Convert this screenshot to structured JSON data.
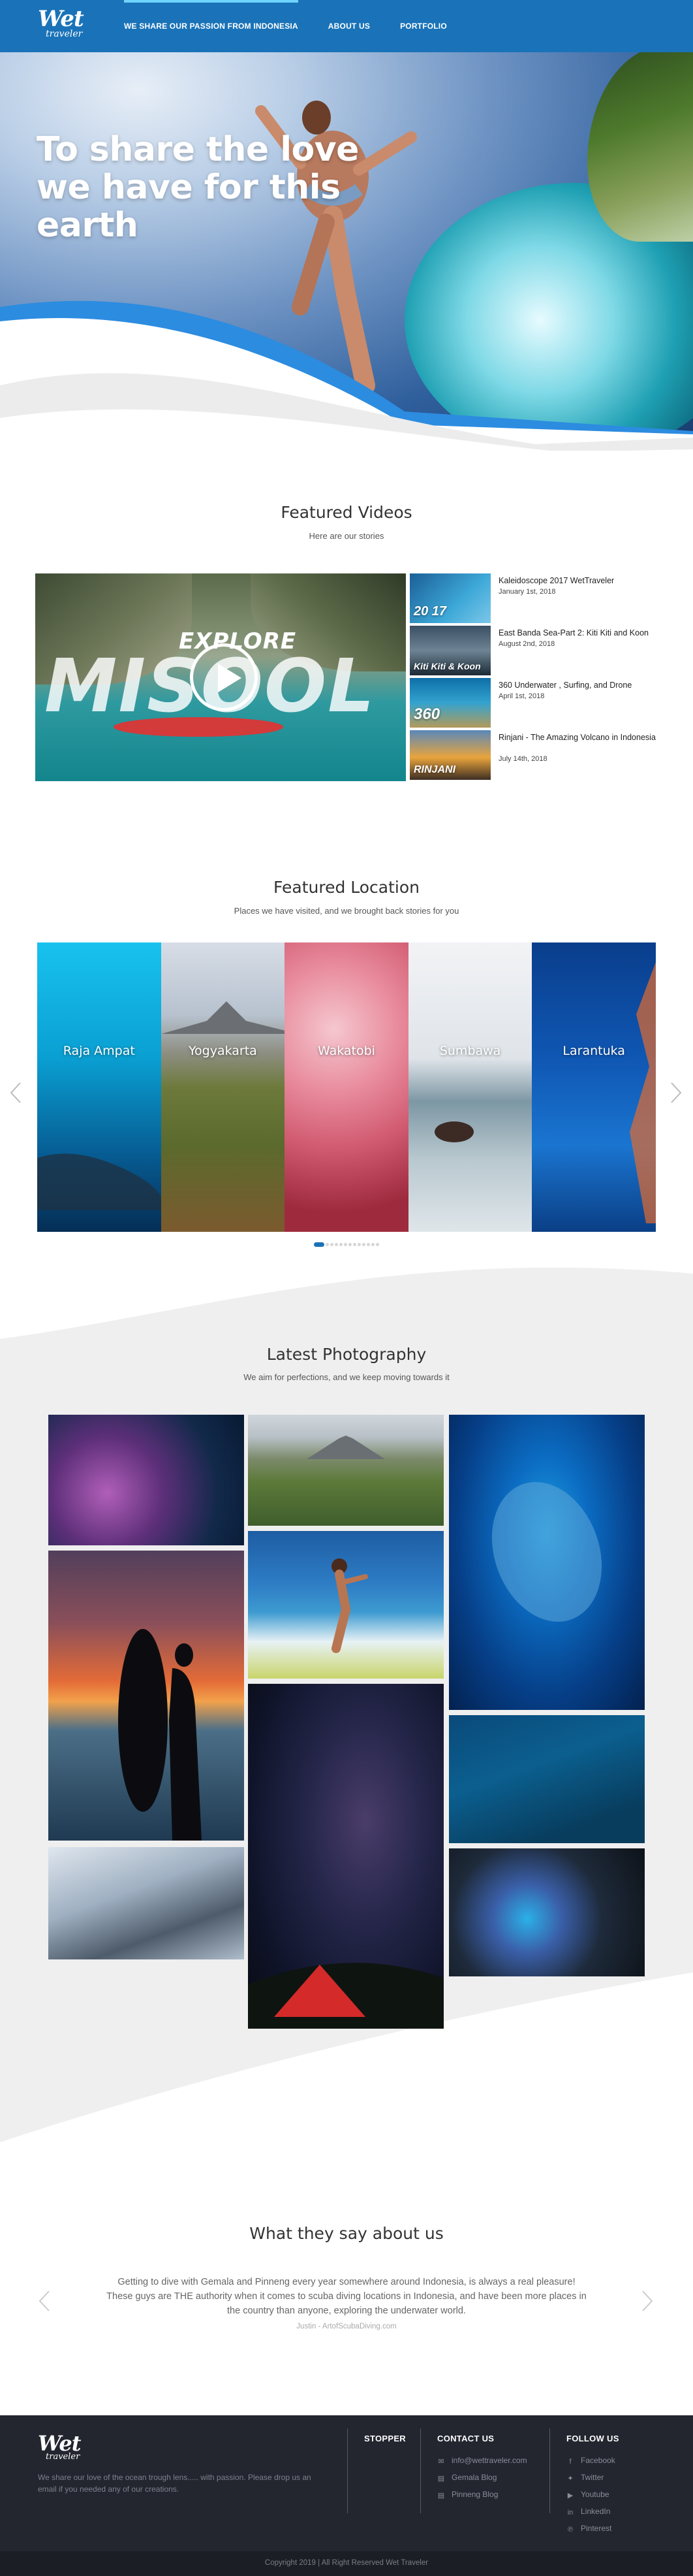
{
  "brand": {
    "logo_main": "Wet",
    "logo_sub": "traveler"
  },
  "nav": {
    "items": [
      {
        "label": "We share our passion from Indonesia",
        "active": true
      },
      {
        "label": "About us",
        "active": false
      },
      {
        "label": "Portfolio",
        "active": false
      }
    ]
  },
  "hero": {
    "headline": "To share the love we have for this earth"
  },
  "videos": {
    "title": "Featured Videos",
    "subtitle": "Here are our stories",
    "main": {
      "text_top": "EXPLORE",
      "text_big": "MISOOL",
      "icon": "play-icon"
    },
    "items": [
      {
        "title": "Kaleidoscope 2017 WetTraveler",
        "date": "January 1st, 2018",
        "thumb_text": "20 17"
      },
      {
        "title": "East Banda Sea-Part 2: Kiti Kiti and Koon",
        "date": "August 2nd, 2018",
        "thumb_text": "Kiti Kiti & Koon"
      },
      {
        "title": "360 Underwater , Surfing, and Drone",
        "date": "April 1st, 2018",
        "thumb_text": "360"
      },
      {
        "title": "Rinjani - The Amazing Volcano in Indonesia",
        "date": "July 14th, 2018",
        "thumb_text": "RINJANI"
      }
    ]
  },
  "locations": {
    "title": "Featured Location",
    "subtitle": "Places we have visited, and we brought back stories for you",
    "items": [
      {
        "name": "Raja Ampat"
      },
      {
        "name": "Yogyakarta"
      },
      {
        "name": "Wakatobi"
      },
      {
        "name": "Sumbawa"
      },
      {
        "name": "Larantuka"
      }
    ],
    "dots_total": 13,
    "dots_active": 1
  },
  "photography": {
    "title": "Latest Photography",
    "subtitle": "We aim for perfections, and we keep moving towards it"
  },
  "testimonials": {
    "title": "What they say about us",
    "quote": "Getting to dive with Gemala and Pinneng every year somewhere around Indonesia, is always a real pleasure! These guys are THE authority when it comes to scuba diving locations in Indonesia, and have been more places in the country than anyone, exploring the underwater world.",
    "author": "Justin - ArtofScubaDiving.com"
  },
  "footer": {
    "about": "We share our love of the ocean trough lens..... with passion. Please drop us an email if you needed any of our creations.",
    "stopper_title": "Stopper",
    "contact_title": "Contact us",
    "contact_links": [
      {
        "label": "info@wettraveler.com",
        "icon": "email-icon"
      },
      {
        "label": "Gemala Blog",
        "icon": "blog-icon"
      },
      {
        "label": "Pinneng Blog",
        "icon": "blog-icon"
      }
    ],
    "follow_title": "Follow us",
    "follow_links": [
      {
        "label": "Facebook",
        "icon": "facebook-icon"
      },
      {
        "label": "Twitter",
        "icon": "twitter-icon"
      },
      {
        "label": "Youtube",
        "icon": "youtube-icon"
      },
      {
        "label": "LinkedIn",
        "icon": "linkedin-icon"
      },
      {
        "label": "Pinterest",
        "icon": "pinterest-icon"
      }
    ],
    "copyright": "Copyright 2019 | All Right Reserved Wet Traveler"
  },
  "colors": {
    "brand_blue": "#1a73b8",
    "footer_bg": "#23252f",
    "band_gray": "#efefef"
  }
}
